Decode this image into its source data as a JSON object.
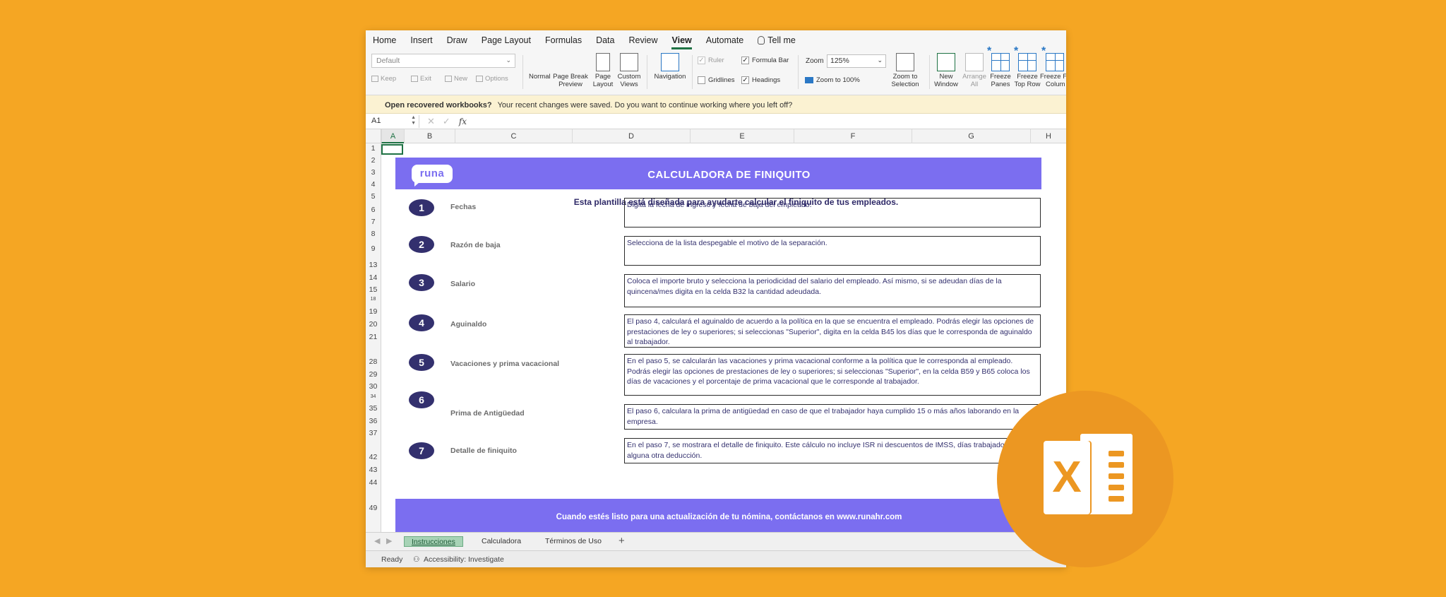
{
  "menu": [
    "Home",
    "Insert",
    "Draw",
    "Page Layout",
    "Formulas",
    "Data",
    "Review",
    "View",
    "Automate",
    "Tell me"
  ],
  "ribbon": {
    "style_value": "Default",
    "sheet_view_buttons": [
      "Keep",
      "Exit",
      "New",
      "Options"
    ],
    "view_buttons": [
      {
        "line1": "Normal",
        "line2": ""
      },
      {
        "line1": "Page Break",
        "line2": "Preview"
      },
      {
        "line1": "Page",
        "line2": "Layout"
      },
      {
        "line1": "Custom",
        "line2": "Views"
      }
    ],
    "navigation": "Navigation",
    "checks": {
      "ruler": "Ruler",
      "formula_bar": "Formula Bar",
      "gridlines": "Gridlines",
      "headings": "Headings"
    },
    "zoom_label": "Zoom",
    "zoom_value": "125%",
    "zoom_100": "Zoom to 100%",
    "zoom_selection": {
      "line1": "Zoom to",
      "line2": "Selection"
    },
    "window_buttons": [
      {
        "line1": "New",
        "line2": "Window"
      },
      {
        "line1": "Arrange",
        "line2": "All"
      },
      {
        "line1": "Freeze",
        "line2": "Panes"
      },
      {
        "line1": "Freeze",
        "line2": "Top Row"
      },
      {
        "line1": "Freeze F",
        "line2": "Colum"
      }
    ]
  },
  "message": {
    "title": "Open recovered workbooks?",
    "text": "Your recent changes were saved. Do you want to continue working where you left off?"
  },
  "formula_bar": {
    "cell_ref": "A1",
    "fx": "fx"
  },
  "columns": [
    "A",
    "B",
    "C",
    "D",
    "E",
    "F",
    "G",
    "H"
  ],
  "rows": [
    "1",
    "2",
    "3",
    "4",
    "5",
    "6",
    "7",
    "8",
    "9",
    "13",
    "14",
    "15",
    "18",
    "19",
    "20",
    "21",
    "28",
    "29",
    "30",
    "34",
    "35",
    "36",
    "37",
    "42",
    "43",
    "44",
    "49"
  ],
  "sheet": {
    "logo": "runa",
    "title": "CALCULADORA DE FINIQUITO",
    "subtitle": "Esta plantilla está diseñada para ayudarte calcular el finiquito de tus empleados.",
    "steps": [
      {
        "num": "1",
        "label": "Fechas",
        "text": "Digita la fecha de ingreso y fecha de baja del empleado."
      },
      {
        "num": "2",
        "label": "Razón de baja",
        "text": "Selecciona de la lista despegable el motivo de la separación."
      },
      {
        "num": "3",
        "label": "Salario",
        "text": "Coloca el importe bruto y selecciona la periodicidad del salario del empleado. Así mismo, si se adeudan días de la quincena/mes digita en la celda B32 la cantidad adeudada."
      },
      {
        "num": "4",
        "label": "Aguinaldo",
        "text": "El paso 4, calculará el aguinaldo de acuerdo a la política en la que se encuentra el empleado. Podrás elegir las opciones de prestaciones de ley o superiores; si seleccionas \"Superior\", digita en la celda B45 los días que le corresponda de aguinaldo al trabajador."
      },
      {
        "num": "5",
        "label": "Vacaciones y prima vacacional",
        "text": "En el paso 5, se calcularán las vacaciones y prima vacacional conforme a la política que le corresponda al empleado. Podrás elegir las opciones de prestaciones de ley o superiores; si seleccionas \"Superior\", en la celda B59 y B65 coloca los días de vacaciones y el porcentaje de prima vacacional que le corresponde al trabajador."
      },
      {
        "num": "6",
        "label": "Prima de Antigüedad",
        "text": "El paso 6, calculara la prima de antigüedad en caso de que el trabajador haya cumplido 15 o más años laborando en la empresa."
      },
      {
        "num": "7",
        "label": "Detalle de finiquito",
        "text": "En el paso 7, se mostrara el detalle de finiquito. Este cálculo no incluye ISR ni descuentos de IMSS, días trabajados o alguna otra deducción."
      }
    ],
    "footer": "Cuando estés listo para una actualización de tu nómina, contáctanos en www.runahr.com"
  },
  "tabs": {
    "items": [
      "Instrucciones",
      "Calculadora",
      "Términos de Uso"
    ],
    "active": "Instrucciones",
    "add": "+"
  },
  "status": {
    "ready": "Ready",
    "accessibility": "Accessibility: Investigate"
  },
  "colors": {
    "background": "#F5A623",
    "banner": "#7b6ef0",
    "step_circle": "#33306e",
    "excel_accent": "#1f7244",
    "badge": "#EC9722"
  }
}
